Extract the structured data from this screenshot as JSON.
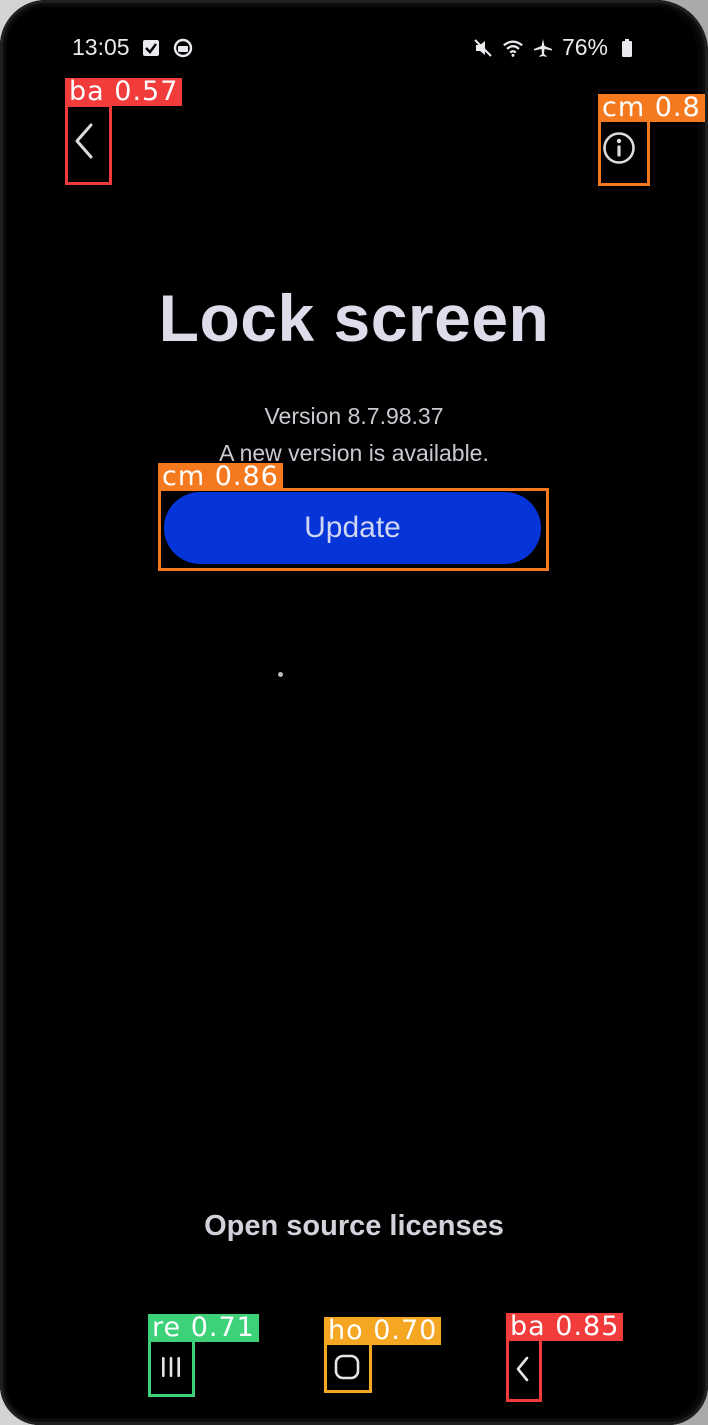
{
  "status_bar": {
    "time": "13:05",
    "battery": "76%",
    "left_icons": [
      "checkbox-notification-icon",
      "app-notification-icon"
    ],
    "right_icons": [
      "mute-icon",
      "wifi-icon",
      "airplane-icon",
      "battery-icon"
    ]
  },
  "top_bar": {
    "back_icon": "chevron-left-icon",
    "info_icon": "info-icon"
  },
  "app": {
    "title": "Lock screen",
    "version": "Version 8.7.98.37",
    "update_notice": "A new version is available.",
    "update_button": "Update",
    "licenses_link": "Open source licenses"
  },
  "bottom_nav": {
    "recents_icon": "recents-icon",
    "home_icon": "home-icon",
    "back_icon": "back-icon"
  },
  "detections": [
    {
      "label": "ba 0.57",
      "color": "#f23b3b"
    },
    {
      "label": "cm 0.8",
      "color": "#f57a1f"
    },
    {
      "label": "cm 0.86",
      "color": "#f57a1f"
    },
    {
      "label": "re 0.71",
      "color": "#3dd17a"
    },
    {
      "label": "ho 0.70",
      "color": "#f5a623"
    },
    {
      "label": "ba 0.85",
      "color": "#f23b3b"
    }
  ],
  "colors": {
    "background": "#000000",
    "update_button": "#0535d8",
    "text": "#dcdcea"
  }
}
